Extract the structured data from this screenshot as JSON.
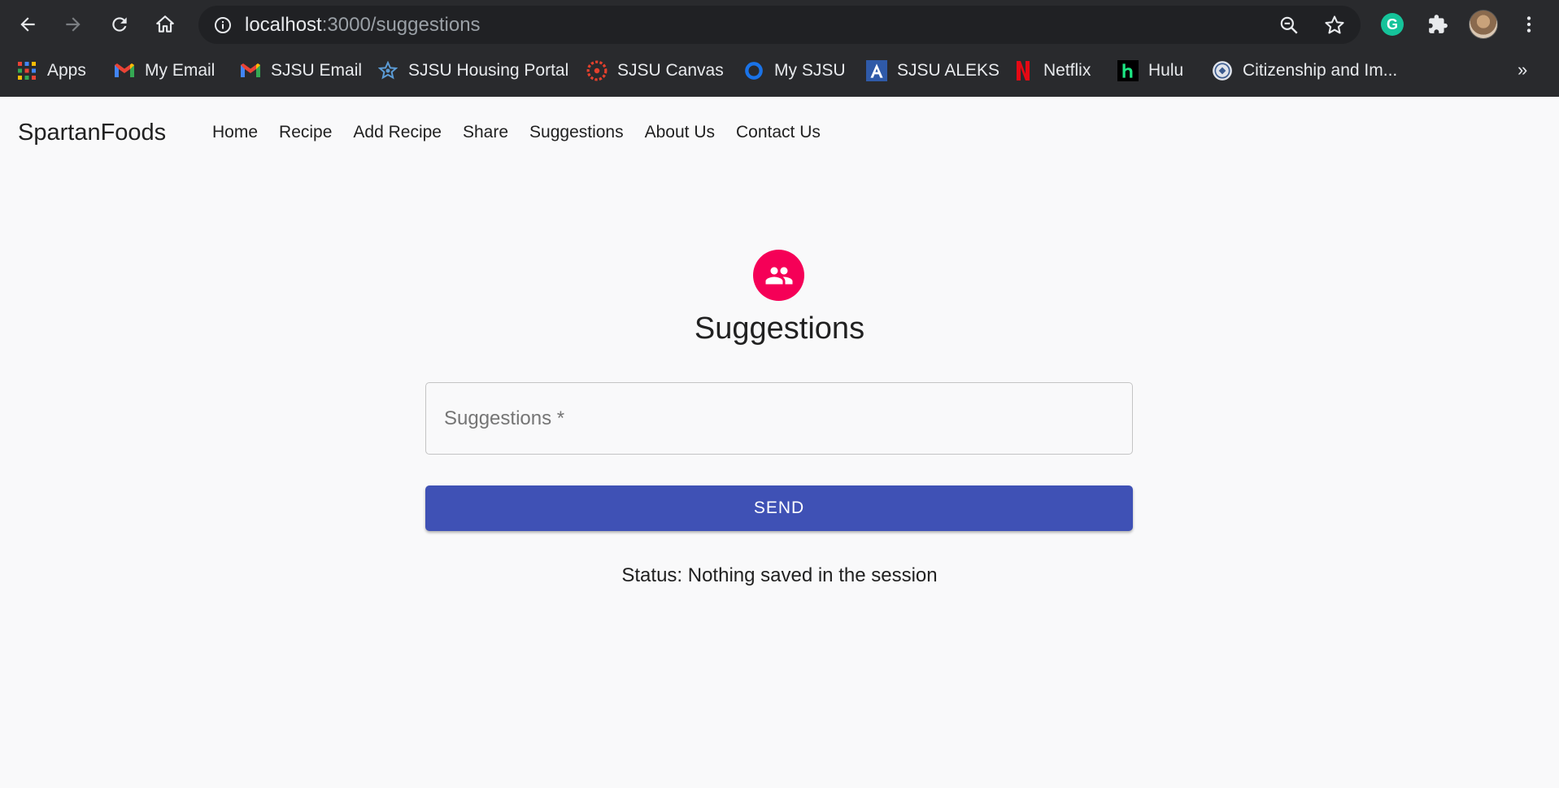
{
  "browser": {
    "url_host": "localhost",
    "url_path": ":3000/suggestions",
    "icons": {
      "back": "arrow-left-icon",
      "forward": "arrow-right-icon",
      "reload": "reload-icon",
      "home": "home-icon",
      "info": "info-icon",
      "zoom": "zoom-out-icon",
      "star": "star-icon",
      "extensions": "puzzle-icon",
      "menu": "kebab-menu-icon"
    },
    "grammarly_letter": "G",
    "bookmarks": [
      {
        "label": "Apps",
        "icon": "apps-grid-icon"
      },
      {
        "label": "My Email",
        "icon": "gmail-icon"
      },
      {
        "label": "SJSU Email",
        "icon": "gmail-icon"
      },
      {
        "label": "SJSU Housing Portal",
        "icon": "star-badge-icon"
      },
      {
        "label": "SJSU Canvas",
        "icon": "canvas-icon"
      },
      {
        "label": "My SJSU",
        "icon": "ring-icon"
      },
      {
        "label": "SJSU ALEKS",
        "icon": "aleks-icon"
      },
      {
        "label": "Netflix",
        "icon": "netflix-icon"
      },
      {
        "label": "Hulu",
        "icon": "hulu-icon"
      },
      {
        "label": "Citizenship and Im...",
        "icon": "seal-icon"
      }
    ],
    "bookmarks_more": "»"
  },
  "app": {
    "brand": "SpartanFoods",
    "nav": [
      "Home",
      "Recipe",
      "Add Recipe",
      "Share",
      "Suggestions",
      "About Us",
      "Contact Us"
    ],
    "header_icon": "people-icon",
    "heading": "Suggestions",
    "field_placeholder": "Suggestions *",
    "field_value": "",
    "send_label": "SEND",
    "status": "Status: Nothing saved in the session",
    "colors": {
      "accent_pink": "#f50057",
      "primary_indigo": "#3f51b5"
    }
  }
}
